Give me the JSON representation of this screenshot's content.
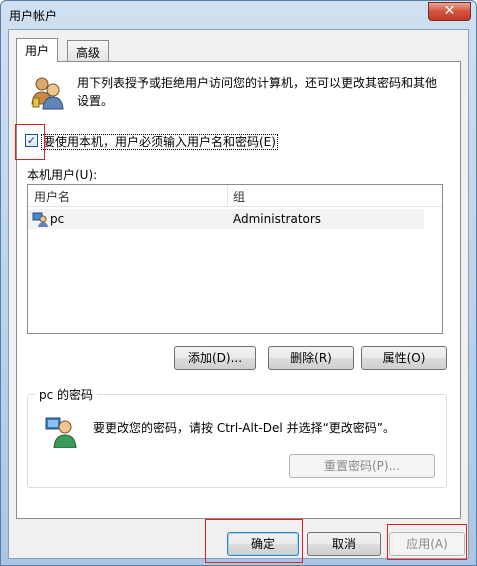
{
  "window": {
    "title": "用户帐户",
    "close_glyph": "✕"
  },
  "tabs": [
    {
      "label": "用户",
      "active": true
    },
    {
      "label": "高级",
      "active": false
    }
  ],
  "intro_text": "用下列表授予或拒绝用户访问您的计算机，还可以更改其密码和其他设置。",
  "require_password": {
    "checked": true,
    "check_glyph": "✓",
    "label": "要使用本机，用户必须输入用户名和密码(E)"
  },
  "local_users_label": "本机用户(U):",
  "users_table": {
    "columns": [
      "用户名",
      "组"
    ],
    "rows": [
      {
        "name": "pc",
        "group": "Administrators"
      }
    ]
  },
  "user_buttons": {
    "add": "添加(D)...",
    "remove": "删除(R)",
    "properties": "属性(O)"
  },
  "password_group": {
    "title": "pc 的密码",
    "text": "要更改您的密码，请按 Ctrl-Alt-Del 并选择“更改密码”。",
    "reset_button": "重置密码(P)..."
  },
  "dialog_buttons": {
    "ok": "确定",
    "cancel": "取消",
    "apply": "应用(A)"
  },
  "colors": {
    "accent_blue": "#3c7fb1",
    "highlight_red": "#e02020"
  }
}
